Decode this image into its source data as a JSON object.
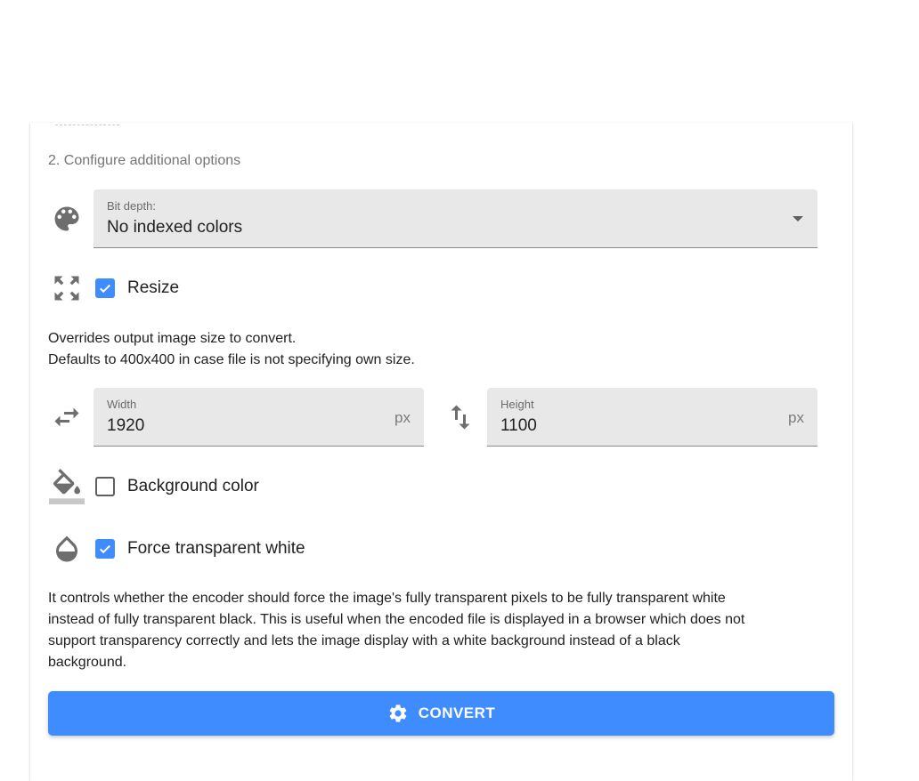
{
  "section": {
    "title": "2. Configure additional options"
  },
  "bit_depth": {
    "label": "Bit depth:",
    "value": "No indexed colors",
    "icon": "palette-icon"
  },
  "resize": {
    "label": "Resize",
    "checked": true,
    "icon": "fullscreen-icon",
    "help_line1": "Overrides output image size to convert.",
    "help_line2": "Defaults to 400x400 in case file is not specifying own size."
  },
  "width": {
    "label": "Width",
    "value": "1920",
    "suffix": "px",
    "icon": "swap-horiz-icon"
  },
  "height": {
    "label": "Height",
    "value": "1100",
    "suffix": "px",
    "icon": "swap-vert-icon"
  },
  "background_color": {
    "label": "Background color",
    "checked": false,
    "icon": "format-color-fill-icon"
  },
  "force_transparent_white": {
    "label": "Force transparent white",
    "checked": true,
    "icon": "opacity-icon",
    "help_line1": "It controls whether the encoder should force the image's fully transparent pixels to be fully transparent white",
    "help_line2": "instead of fully transparent black. This is useful when the encoded file is displayed in a browser which does not",
    "help_line3": "support transparency correctly and lets the image display with a white background instead of a black",
    "help_line4": "background."
  },
  "convert_button": {
    "label": "CONVERT",
    "icon": "gear-icon"
  },
  "colors": {
    "accent": "#3f8cff",
    "field_bg": "#e8e8e8",
    "icon_gray": "#6e6e6e"
  }
}
